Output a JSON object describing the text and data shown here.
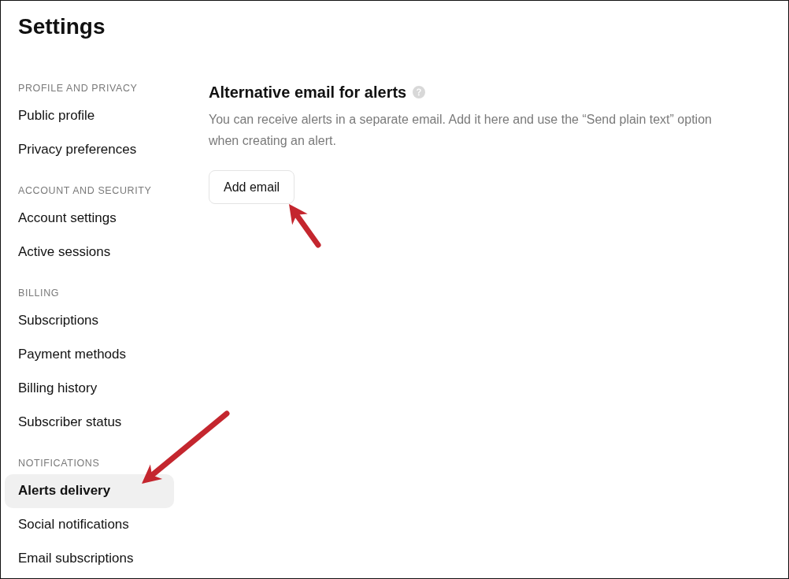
{
  "page": {
    "title": "Settings"
  },
  "sidebar": {
    "sections": [
      {
        "heading": "PROFILE AND PRIVACY",
        "items": [
          {
            "label": "Public profile",
            "selected": false,
            "annotated": false
          },
          {
            "label": "Privacy preferences",
            "selected": false,
            "annotated": false
          }
        ]
      },
      {
        "heading": "ACCOUNT AND SECURITY",
        "items": [
          {
            "label": "Account settings",
            "selected": false,
            "annotated": false
          },
          {
            "label": "Active sessions",
            "selected": false,
            "annotated": false
          }
        ]
      },
      {
        "heading": "BILLING",
        "items": [
          {
            "label": "Subscriptions",
            "selected": false,
            "annotated": false
          },
          {
            "label": "Payment methods",
            "selected": false,
            "annotated": false
          },
          {
            "label": "Billing history",
            "selected": false,
            "annotated": false
          },
          {
            "label": "Subscriber status",
            "selected": false,
            "annotated": false
          }
        ]
      },
      {
        "heading": "NOTIFICATIONS",
        "items": [
          {
            "label": "Alerts delivery",
            "selected": true,
            "annotated": true
          },
          {
            "label": "Social notifications",
            "selected": false,
            "annotated": false
          },
          {
            "label": "Email subscriptions",
            "selected": false,
            "annotated": false
          }
        ]
      }
    ]
  },
  "main": {
    "heading": "Alternative email for alerts",
    "description": "You can receive alerts in a separate email. Add it here and use the “Send plain text” option when creating an alert.",
    "button": {
      "label": "Add email",
      "annotated": true
    }
  }
}
